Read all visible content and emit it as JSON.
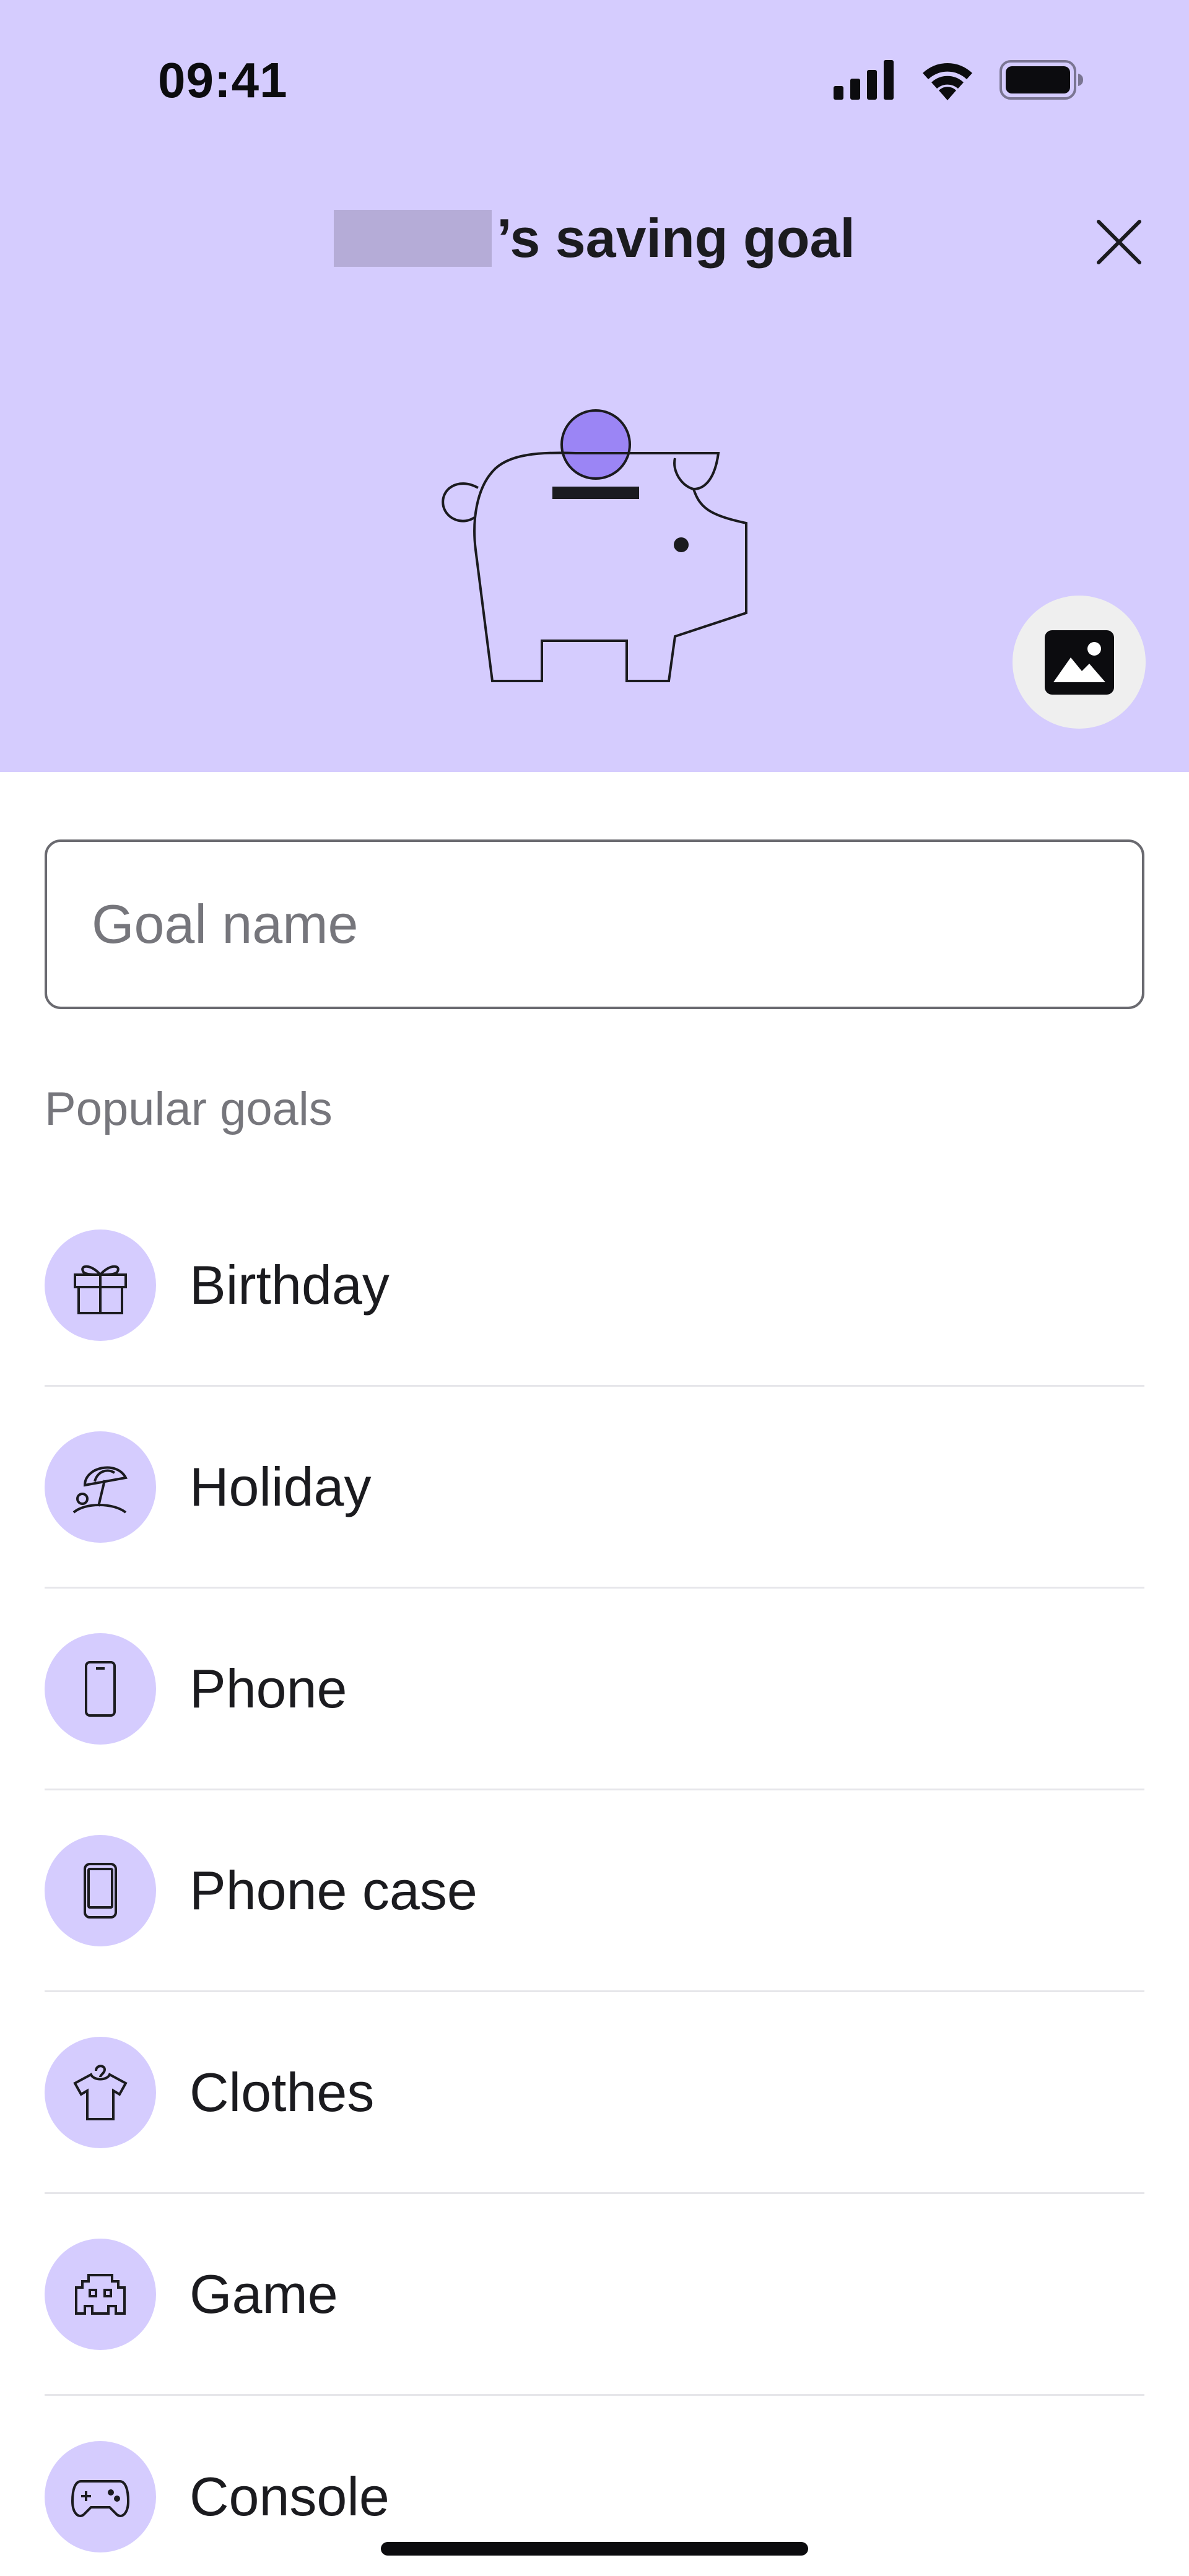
{
  "status_bar": {
    "time": "09:41",
    "icons": [
      "signal-icon",
      "wifi-icon",
      "battery-icon"
    ]
  },
  "header": {
    "title_suffix": "’s saving goal",
    "close_icon": "close-icon",
    "illustration": "piggy-bank-illustration",
    "photo_button_icon": "image-icon",
    "background_color": "#d5ccfe",
    "accent_color": "#9b85f5"
  },
  "goal_input": {
    "value": "",
    "placeholder": "Goal name"
  },
  "popular_goals": {
    "label": "Popular goals",
    "items": [
      {
        "label": "Birthday",
        "icon": "gift-icon"
      },
      {
        "label": "Holiday",
        "icon": "beach-umbrella-icon"
      },
      {
        "label": "Phone",
        "icon": "phone-icon"
      },
      {
        "label": "Phone case",
        "icon": "phone-case-icon"
      },
      {
        "label": "Clothes",
        "icon": "tshirt-icon"
      },
      {
        "label": "Game",
        "icon": "space-invader-icon"
      },
      {
        "label": "Console",
        "icon": "gamepad-icon"
      }
    ]
  }
}
